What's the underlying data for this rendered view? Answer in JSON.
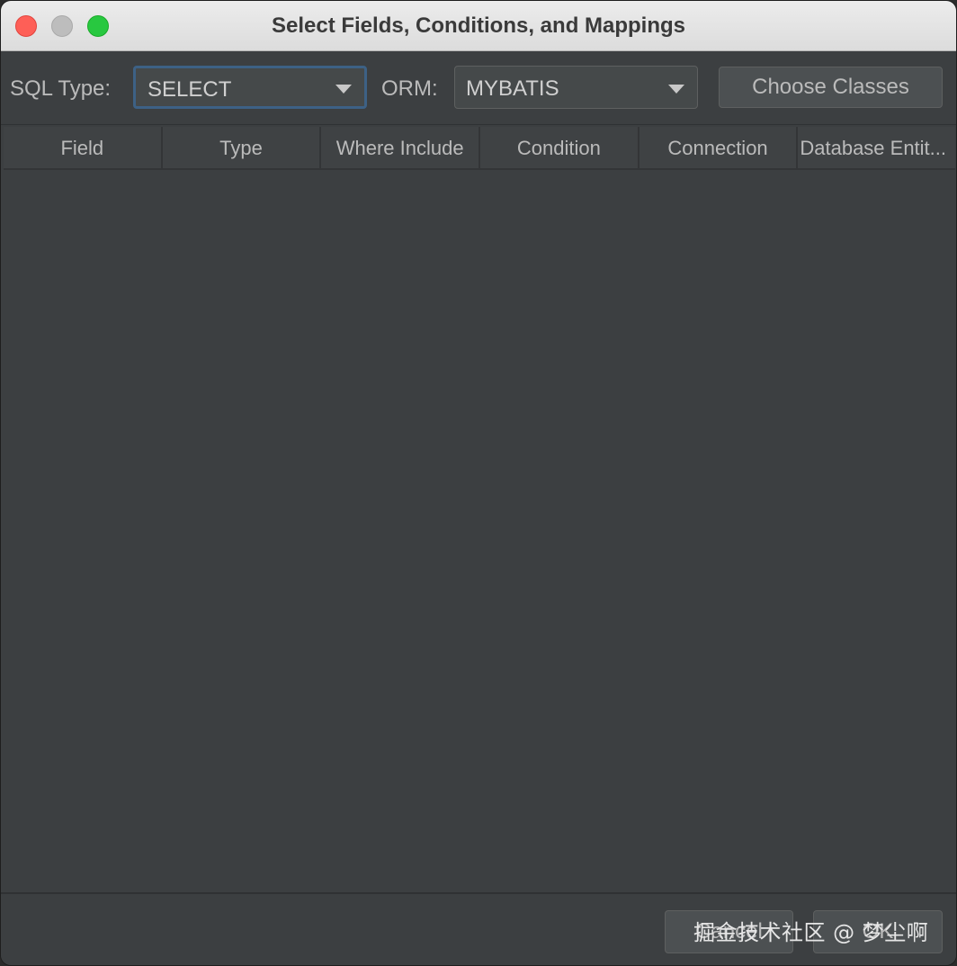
{
  "window": {
    "title": "Select Fields, Conditions, and Mappings"
  },
  "toolbar": {
    "sql_type_label": "SQL Type:",
    "sql_type_value": "SELECT",
    "orm_label": "ORM:",
    "orm_value": "MYBATIS",
    "choose_classes_label": "Choose Classes"
  },
  "table": {
    "columns": [
      "Field",
      "Type",
      "Where Include",
      "Condition",
      "Connection",
      "Database Entit..."
    ],
    "rows": []
  },
  "footer": {
    "cancel_label": "Cancel",
    "ok_label": "OK"
  },
  "watermark": {
    "text": "掘金技术社区 @ 梦尘啊"
  },
  "colors": {
    "background": "#3c3f41",
    "focus_border": "#3d6185",
    "text": "#bbbbbb",
    "close": "#fe5f57",
    "zoom": "#28c840"
  }
}
